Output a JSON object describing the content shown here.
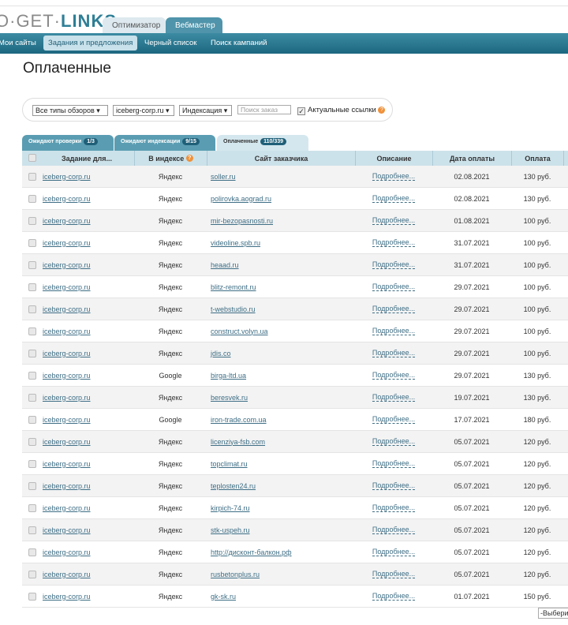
{
  "logo": {
    "left": "O·GET·",
    "right": "LINKS"
  },
  "top_tabs": [
    "Оптимизатор",
    "Вебмастер"
  ],
  "nav": [
    "Мои сайты",
    "Задания и предложения",
    "Черный список",
    "Поиск кампаний"
  ],
  "page_title": "Оплаченные",
  "filters": {
    "type": "Все типы обзоров ▾",
    "site": "iceberg-corp.ru ▾",
    "index": "Индексация ▾",
    "search_placeholder": "Поиск заказ",
    "actual_label": "Актуальные ссылки",
    "actual_checked": true
  },
  "status_tabs": [
    {
      "label": "Ожидают проверки",
      "count": "1/3"
    },
    {
      "label": "Ожидают индексации",
      "count": "9/15"
    },
    {
      "label": "Оплаченные",
      "count": "110/339"
    }
  ],
  "columns": [
    "Задание для...",
    "В индексе",
    "Сайт заказчика",
    "Описание",
    "Дата оплаты",
    "Оплата"
  ],
  "rows": [
    [
      "iceberg-corp.ru",
      "Яндекс",
      "soller.ru",
      "Подробнее...",
      "02.08.2021",
      "130 руб."
    ],
    [
      "iceberg-corp.ru",
      "Яндекс",
      "polirovka.aograd.ru",
      "Подробнее...",
      "02.08.2021",
      "130 руб."
    ],
    [
      "iceberg-corp.ru",
      "Яндекс",
      "mir-bezopasnosti.ru",
      "Подробнее...",
      "01.08.2021",
      "100 руб."
    ],
    [
      "iceberg-corp.ru",
      "Яндекс",
      "videoline.spb.ru",
      "Подробнее...",
      "31.07.2021",
      "100 руб."
    ],
    [
      "iceberg-corp.ru",
      "Яндекс",
      "heaad.ru",
      "Подробнее...",
      "31.07.2021",
      "100 руб."
    ],
    [
      "iceberg-corp.ru",
      "Яндекс",
      "blitz-remont.ru",
      "Подробнее...",
      "29.07.2021",
      "100 руб."
    ],
    [
      "iceberg-corp.ru",
      "Яндекс",
      "t-webstudio.ru",
      "Подробнее...",
      "29.07.2021",
      "100 руб."
    ],
    [
      "iceberg-corp.ru",
      "Яндекс",
      "construct.volyn.ua",
      "Подробнее...",
      "29.07.2021",
      "100 руб."
    ],
    [
      "iceberg-corp.ru",
      "Яндекс",
      "jdis.co",
      "Подробнее...",
      "29.07.2021",
      "100 руб."
    ],
    [
      "iceberg-corp.ru",
      "Google",
      "birga-ltd.ua",
      "Подробнее...",
      "29.07.2021",
      "130 руб."
    ],
    [
      "iceberg-corp.ru",
      "Яндекс",
      "beresvek.ru",
      "Подробнее...",
      "19.07.2021",
      "130 руб."
    ],
    [
      "iceberg-corp.ru",
      "Google",
      "iron-trade.com.ua",
      "Подробнее...",
      "17.07.2021",
      "180 руб."
    ],
    [
      "iceberg-corp.ru",
      "Яндекс",
      "licenziya-fsb.com",
      "Подробнее...",
      "05.07.2021",
      "120 руб."
    ],
    [
      "iceberg-corp.ru",
      "Яндекс",
      "topclimat.ru",
      "Подробнее...",
      "05.07.2021",
      "120 руб."
    ],
    [
      "iceberg-corp.ru",
      "Яндекс",
      "teplosten24.ru",
      "Подробнее...",
      "05.07.2021",
      "120 руб."
    ],
    [
      "iceberg-corp.ru",
      "Яндекс",
      "kirpich-74.ru",
      "Подробнее...",
      "05.07.2021",
      "120 руб."
    ],
    [
      "iceberg-corp.ru",
      "Яндекс",
      "stk-uspeh.ru",
      "Подробнее...",
      "05.07.2021",
      "120 руб."
    ],
    [
      "iceberg-corp.ru",
      "Яндекс",
      "http://дисконт-балкон.рф",
      "Подробнее...",
      "05.07.2021",
      "120 руб."
    ],
    [
      "iceberg-corp.ru",
      "Яндекс",
      "rusbetonplus.ru",
      "Подробнее...",
      "05.07.2021",
      "120 руб."
    ],
    [
      "iceberg-corp.ru",
      "Яндекс",
      "gk-sk.ru",
      "Подробнее...",
      "01.07.2021",
      "150 руб."
    ]
  ],
  "pager_select": "-Выбери"
}
